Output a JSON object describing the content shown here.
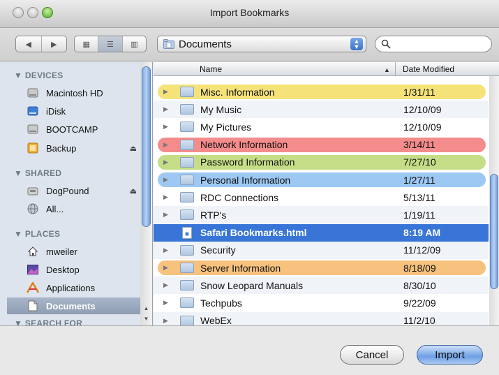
{
  "window": {
    "title": "Import Bookmarks"
  },
  "toolbar": {
    "location": "Documents",
    "search_placeholder": ""
  },
  "sidebar": {
    "devices_label": "DEVICES",
    "shared_label": "SHARED",
    "places_label": "PLACES",
    "search_label": "SEARCH FOR",
    "devices": [
      {
        "label": "Macintosh HD"
      },
      {
        "label": "iDisk"
      },
      {
        "label": "BOOTCAMP"
      },
      {
        "label": "Backup"
      }
    ],
    "shared": [
      {
        "label": "DogPound"
      },
      {
        "label": "All..."
      }
    ],
    "places": [
      {
        "label": "mweiler"
      },
      {
        "label": "Desktop"
      },
      {
        "label": "Applications"
      },
      {
        "label": "Documents"
      }
    ]
  },
  "list": {
    "col_name": "Name",
    "col_date": "Date Modified",
    "rows": [
      {
        "name": "Misc. Information",
        "date": "1/31/11",
        "label": "#f5e37a"
      },
      {
        "name": "My Music",
        "date": "12/10/09",
        "label": ""
      },
      {
        "name": "My Pictures",
        "date": "12/10/09",
        "label": ""
      },
      {
        "name": "Network Information",
        "date": "3/14/11",
        "label": "#f48c8c"
      },
      {
        "name": "Password Information",
        "date": "7/27/10",
        "label": "#c5dd86"
      },
      {
        "name": "Personal Information",
        "date": "1/27/11",
        "label": "#9cc8f3"
      },
      {
        "name": "RDC Connections",
        "date": "5/13/11",
        "label": ""
      },
      {
        "name": "RTP's",
        "date": "1/19/11",
        "label": ""
      },
      {
        "name": "Safari Bookmarks.html",
        "date": "8:19 AM",
        "label": ""
      },
      {
        "name": "Security",
        "date": "11/12/09",
        "label": ""
      },
      {
        "name": "Server Information",
        "date": "8/18/09",
        "label": "#f7c27e"
      },
      {
        "name": "Snow Leopard Manuals",
        "date": "8/30/10",
        "label": ""
      },
      {
        "name": "Techpubs",
        "date": "9/22/09",
        "label": ""
      },
      {
        "name": "WebEx",
        "date": "11/2/10",
        "label": ""
      }
    ]
  },
  "buttons": {
    "cancel": "Cancel",
    "import": "Import"
  }
}
